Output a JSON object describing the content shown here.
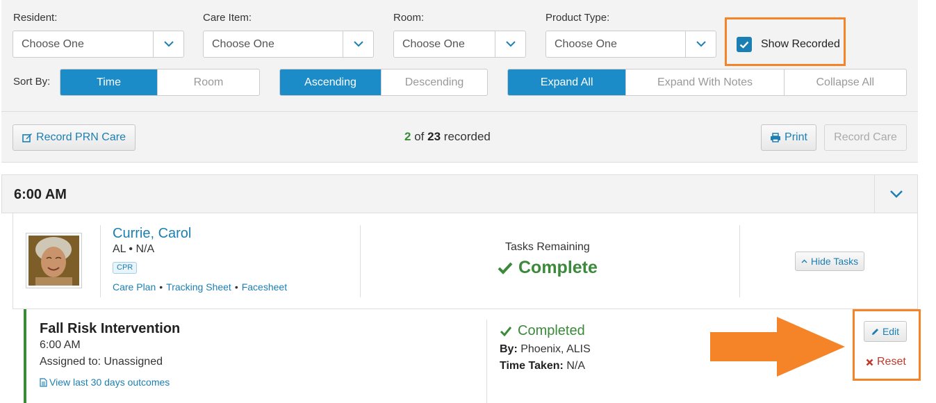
{
  "filters": {
    "resident": {
      "label": "Resident:",
      "value": "Choose One"
    },
    "care_item": {
      "label": "Care Item:",
      "value": "Choose One"
    },
    "room": {
      "label": "Room:",
      "value": "Choose One"
    },
    "product_type": {
      "label": "Product Type:",
      "value": "Choose One"
    },
    "show_recorded": {
      "label": "Show Recorded",
      "checked": true
    }
  },
  "sort": {
    "label": "Sort By:",
    "by": [
      {
        "label": "Time",
        "active": true
      },
      {
        "label": "Room",
        "active": false
      }
    ],
    "order": [
      {
        "label": "Ascending",
        "active": true
      },
      {
        "label": "Descending",
        "active": false
      }
    ],
    "expand": [
      {
        "label": "Expand All",
        "active": true
      },
      {
        "label": "Expand With Notes",
        "active": false
      },
      {
        "label": "Collapse All",
        "active": false
      }
    ]
  },
  "actions": {
    "record_prn": "Record PRN Care",
    "recorded_done": "2",
    "recorded_of": "of",
    "recorded_total": "23",
    "recorded_suffix": "recorded",
    "print": "Print",
    "record_care": "Record Care"
  },
  "time_group": {
    "label": "6:00 AM"
  },
  "resident": {
    "name": "Currie, Carol",
    "sub": "AL  • N/A",
    "badge": "CPR",
    "links": [
      "Care Plan",
      "Tracking Sheet",
      "Facesheet"
    ],
    "tasks_remaining_label": "Tasks Remaining",
    "tasks_status": "Complete",
    "hide_tasks": "Hide Tasks"
  },
  "task": {
    "title": "Fall Risk Intervention",
    "time": "6:00 AM",
    "assigned": "Assigned to: Unassigned",
    "outcomes_link": "View last 30 days outcomes",
    "status": "Completed",
    "by_label": "By:",
    "by_value": "Phoenix, ALIS",
    "time_taken_label": "Time Taken:",
    "time_taken_value": "N/A",
    "edit": "Edit",
    "reset": "Reset"
  },
  "colors": {
    "accent": "#1b8cc8",
    "link": "#1b7fb3",
    "success": "#3a8a3a",
    "danger": "#c0392b",
    "highlight": "#f58429"
  }
}
